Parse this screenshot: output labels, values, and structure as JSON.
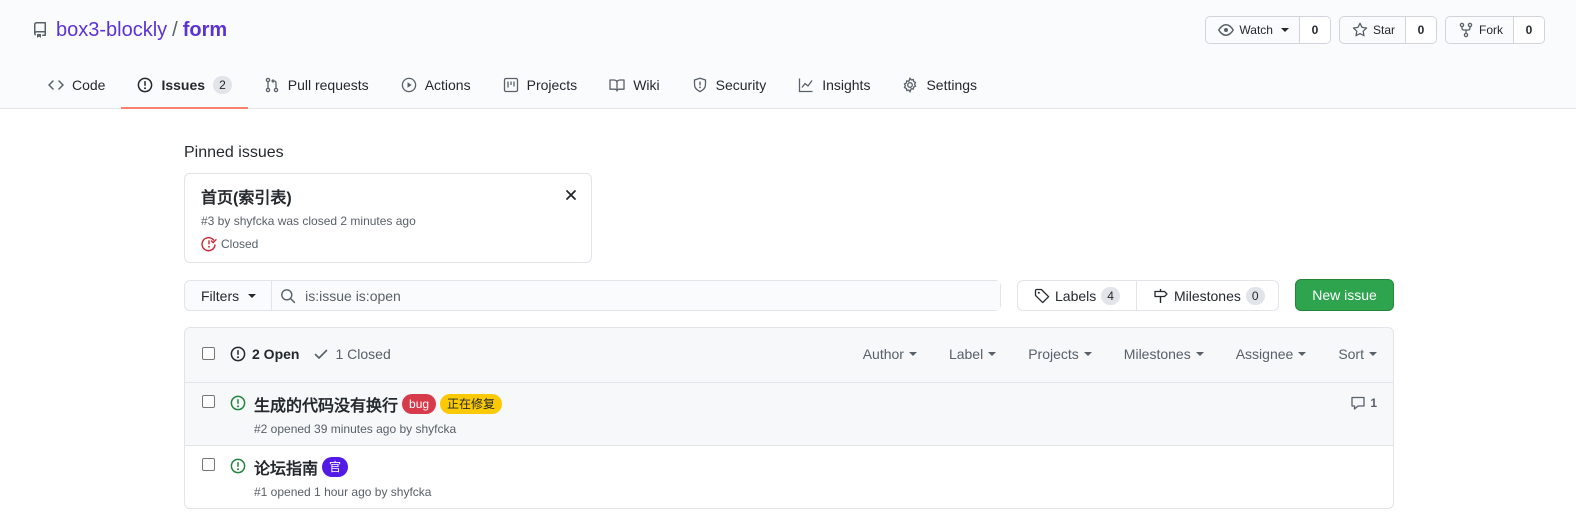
{
  "repo": {
    "owner": "box3-blockly",
    "separator": "/",
    "name": "form"
  },
  "repo_actions": [
    {
      "label": "Watch",
      "count": "0",
      "icon": "eye-icon",
      "dropdown": true
    },
    {
      "label": "Star",
      "count": "0",
      "icon": "star-icon",
      "dropdown": false
    },
    {
      "label": "Fork",
      "count": "0",
      "icon": "fork-icon",
      "dropdown": false
    }
  ],
  "tabs": [
    {
      "label": "Code",
      "icon": "code-icon"
    },
    {
      "label": "Issues",
      "icon": "issue-opened-icon",
      "counter": "2",
      "selected": true
    },
    {
      "label": "Pull requests",
      "icon": "pull-request-icon"
    },
    {
      "label": "Actions",
      "icon": "play-icon"
    },
    {
      "label": "Projects",
      "icon": "project-icon"
    },
    {
      "label": "Wiki",
      "icon": "book-icon"
    },
    {
      "label": "Security",
      "icon": "shield-icon"
    },
    {
      "label": "Insights",
      "icon": "graph-icon"
    },
    {
      "label": "Settings",
      "icon": "gear-icon"
    }
  ],
  "pinned": {
    "heading": "Pinned issues",
    "issue": {
      "title": "首页(索引表)",
      "meta": "#3 by shyfcka was closed 2 minutes ago",
      "status": "Closed"
    }
  },
  "filters": {
    "button_label": "Filters",
    "search_value": "is:issue is:open"
  },
  "labels_button": {
    "label": "Labels",
    "count": "4"
  },
  "milestones_button": {
    "label": "Milestones",
    "count": "0"
  },
  "new_issue_label": "New issue",
  "list": {
    "open_label": "2 Open",
    "closed_label": "1 Closed",
    "sort_menus": [
      "Author",
      "Label",
      "Projects",
      "Milestones",
      "Assignee",
      "Sort"
    ],
    "issues": [
      {
        "title": "生成的代码没有换行",
        "labels": [
          {
            "text": "bug",
            "bg": "#d73a4a",
            "fg": "#ffffff"
          },
          {
            "text": "正在修复",
            "bg": "#fbca04",
            "fg": "#24292e"
          }
        ],
        "meta": "#2 opened 39 minutes ago by shyfcka",
        "comments": "1"
      },
      {
        "title": "论坛指南",
        "labels": [
          {
            "text": "官",
            "bg": "#5319e7",
            "fg": "#ffffff"
          }
        ],
        "meta": "#1 opened 1 hour ago by shyfcka",
        "comments": ""
      }
    ]
  },
  "colors": {
    "accent": "#5a32d6",
    "open": "#22863a",
    "closed": "#cb2431",
    "primary_button": "#2ea44f",
    "tab_underline": "#f9826c"
  }
}
